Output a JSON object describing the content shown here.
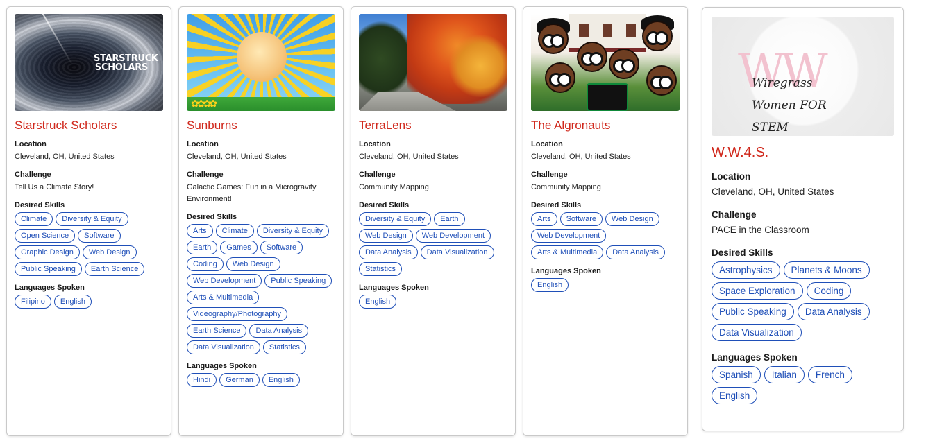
{
  "labels": {
    "location": "Location",
    "challenge": "Challenge",
    "skills": "Desired Skills",
    "languages": "Languages Spoken"
  },
  "teams": [
    {
      "name": "Starstruck Scholars",
      "thumbnail_text": "STARSTRUCK SCHOLARS",
      "location": "Cleveland, OH, United States",
      "challenge": "Tell Us a Climate Story!",
      "skills": [
        "Climate",
        "Diversity & Equity",
        "Open Science",
        "Software",
        "Graphic Design",
        "Web Design",
        "Public Speaking",
        "Earth Science"
      ],
      "languages": [
        "Filipino",
        "English"
      ]
    },
    {
      "name": "Sunburns",
      "location": "Cleveland, OH, United States",
      "challenge": "Galactic Games: Fun in a Microgravity Environment!",
      "skills": [
        "Arts",
        "Climate",
        "Diversity & Equity",
        "Earth",
        "Games",
        "Software",
        "Coding",
        "Web Design",
        "Web Development",
        "Public Speaking",
        "Arts & Multimedia",
        "Videography/Photography",
        "Earth Science",
        "Data Analysis",
        "Data Visualization",
        "Statistics"
      ],
      "languages": [
        "Hindi",
        "German",
        "English"
      ]
    },
    {
      "name": "TerraLens",
      "location": "Cleveland, OH, United States",
      "challenge": "Community Mapping",
      "skills": [
        "Diversity & Equity",
        "Earth",
        "Web Design",
        "Web Development",
        "Data Analysis",
        "Data Visualization",
        "Statistics"
      ],
      "languages": [
        "English"
      ]
    },
    {
      "name": "The Algronauts",
      "location": "Cleveland, OH, United States",
      "challenge": "Community Mapping",
      "skills": [
        "Arts",
        "Software",
        "Web Design",
        "Web Development",
        "Arts & Multimedia",
        "Data Analysis"
      ],
      "languages": [
        "English"
      ]
    },
    {
      "name": "W.W.4.S.",
      "thumbnail_text": "Wiregrass Women FOR STEM",
      "location": "Cleveland, OH, United States",
      "challenge": "PACE in the Classroom",
      "skills": [
        "Astrophysics",
        "Planets & Moons",
        "Space Exploration",
        "Coding",
        "Public Speaking",
        "Data Analysis",
        "Data Visualization"
      ],
      "languages": [
        "Spanish",
        "Italian",
        "French",
        "English"
      ]
    }
  ]
}
